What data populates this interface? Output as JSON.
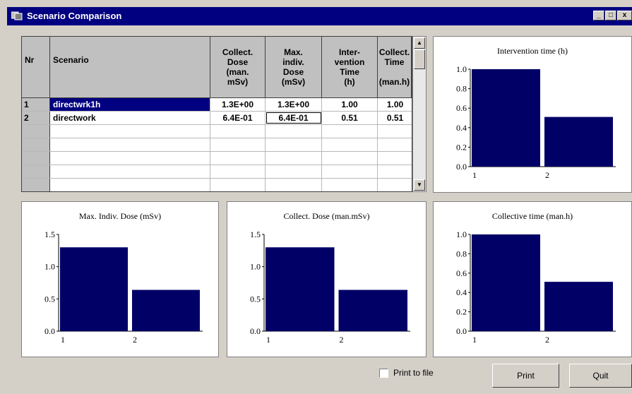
{
  "window": {
    "title": "Scenario Comparison",
    "controls": [
      "_",
      "□",
      "x"
    ]
  },
  "table": {
    "headers": {
      "nr": "Nr",
      "scenario": "Scenario",
      "collect_dose": [
        "Collect.",
        "Dose",
        "(man.",
        "mSv)"
      ],
      "max_dose": [
        "Max.",
        "indiv.",
        "Dose",
        "(mSv)"
      ],
      "intervention": [
        "Inter-",
        "vention",
        "Time",
        "(h)"
      ],
      "collect_time": [
        "Collect.",
        "Time",
        "",
        "(man.h)"
      ]
    },
    "rows": [
      {
        "nr": "1",
        "scenario": "directwrk1h",
        "collect_dose": "1.3E+00",
        "max_dose": "1.3E+00",
        "intervention": "1.00",
        "collect_time": "1.00"
      },
      {
        "nr": "2",
        "scenario": "directwork",
        "collect_dose": "6.4E-01",
        "max_dose": "6.4E-01",
        "intervention": "0.51",
        "collect_time": "0.51"
      }
    ]
  },
  "chart_data": [
    {
      "type": "bar",
      "title": "Intervention time (h)",
      "categories": [
        "1",
        "2"
      ],
      "values": [
        1.0,
        0.51
      ],
      "ylim": [
        0,
        1.0
      ],
      "yticks": [
        "0.0",
        "0.2",
        "0.4",
        "0.6",
        "0.8",
        "1.0"
      ],
      "xticks": [
        "1",
        "2"
      ],
      "bar_color": "#000066"
    },
    {
      "type": "bar",
      "title": "Max. Indiv. Dose (mSv)",
      "categories": [
        "1",
        "2"
      ],
      "values": [
        1.3,
        0.64
      ],
      "ylim": [
        0,
        1.5
      ],
      "yticks": [
        "0.0",
        "0.5",
        "1.0",
        "1.5"
      ],
      "xticks": [
        "1",
        "2"
      ],
      "bar_color": "#000066"
    },
    {
      "type": "bar",
      "title": "Collect. Dose (man.mSv)",
      "categories": [
        "1",
        "2"
      ],
      "values": [
        1.3,
        0.64
      ],
      "ylim": [
        0,
        1.5
      ],
      "yticks": [
        "0.0",
        "0.5",
        "1.0",
        "1.5"
      ],
      "xticks": [
        "1",
        "2"
      ],
      "bar_color": "#000066"
    },
    {
      "type": "bar",
      "title": "Collective time (man.h)",
      "categories": [
        "1",
        "2"
      ],
      "values": [
        1.0,
        0.51
      ],
      "ylim": [
        0,
        1.0
      ],
      "yticks": [
        "0.0",
        "0.2",
        "0.4",
        "0.6",
        "0.8",
        "1.0"
      ],
      "xticks": [
        "1",
        "2"
      ],
      "bar_color": "#000066"
    }
  ],
  "footer": {
    "print_to_file_label": "Print to file",
    "print_to_file_checked": false,
    "print_button": "Print",
    "quit_button": "Quit"
  }
}
